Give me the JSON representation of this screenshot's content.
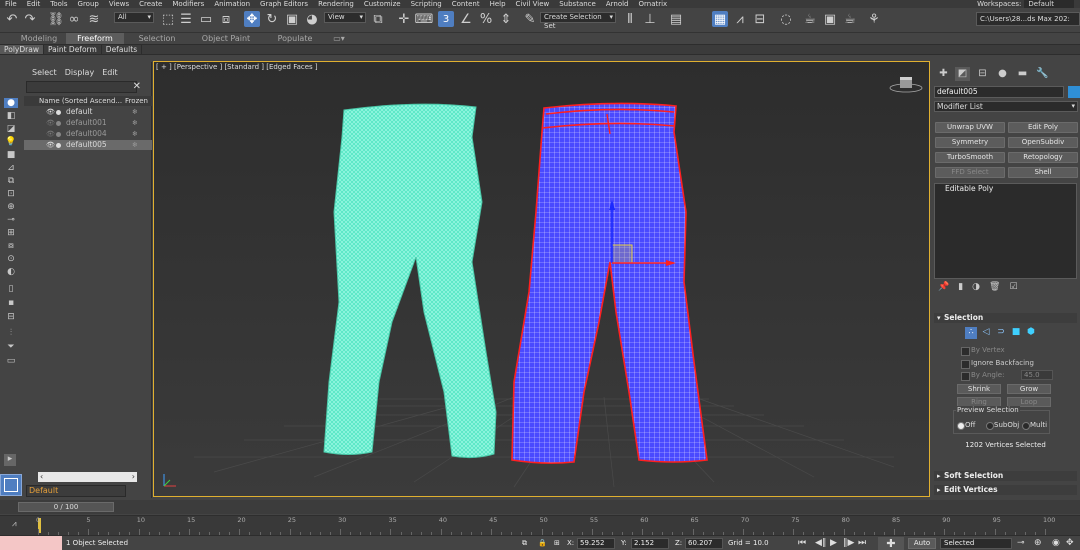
{
  "menu": {
    "items": [
      "File",
      "Edit",
      "Tools",
      "Group",
      "Views",
      "Create",
      "Modifiers",
      "Animation",
      "Graph Editors",
      "Rendering",
      "Customize",
      "Scripting",
      "Content",
      "Help",
      "Civil View",
      "Substance",
      "Arnold",
      "Ornatrix"
    ],
    "workspaces_label": "Workspaces:",
    "workspaces_value": "Default"
  },
  "toolbar": {
    "filter_value": "All",
    "refcoord_value": "View",
    "selection_set_placeholder": "Create Selection Set",
    "project_path": "C:\\Users\\28...ds Max 202:"
  },
  "ribbon": {
    "tabs": [
      "Modeling",
      "Freeform",
      "Selection",
      "Object Paint",
      "Populate"
    ],
    "active_tab": "Freeform",
    "subtabs": [
      "PolyDraw",
      "Paint Deform",
      "Defaults"
    ]
  },
  "explorer": {
    "menu": [
      "Select",
      "Display",
      "Edit"
    ],
    "column_name": "Name (Sorted Ascend...",
    "column_frozen": "Frozen",
    "rows": [
      {
        "name": "default",
        "dim": false,
        "selected": false
      },
      {
        "name": "default001",
        "dim": true,
        "selected": false
      },
      {
        "name": "default004",
        "dim": true,
        "selected": false
      },
      {
        "name": "default005",
        "dim": false,
        "selected": true
      }
    ],
    "layer": "Default"
  },
  "viewport": {
    "label": "[ + ] [Perspective ] [Standard ] [Edged Faces ]",
    "accent": "#e0b030",
    "mesh_left_color": "#5fe8c8",
    "mesh_right_color": "#4a4aff",
    "selection_edge_color": "#ff2020"
  },
  "command_panel": {
    "object_name": "default005",
    "object_color": "#2f8fd6",
    "modifier_list": "Modifier List",
    "buttons": [
      {
        "label": "Unwrap UVW",
        "disabled": false
      },
      {
        "label": "Edit Poly",
        "disabled": false
      },
      {
        "label": "Symmetry",
        "disabled": false
      },
      {
        "label": "OpenSubdiv",
        "disabled": false
      },
      {
        "label": "TurboSmooth",
        "disabled": false
      },
      {
        "label": "Retopology",
        "disabled": false
      },
      {
        "label": "FFD Select",
        "disabled": true
      },
      {
        "label": "Shell",
        "disabled": false
      }
    ],
    "stack_item": "Editable Poly",
    "selection": {
      "title": "Selection",
      "by_vertex": "By Vertex",
      "ignore_backfacing": "Ignore Backfacing",
      "by_angle": "By Angle:",
      "angle_value": "45.0",
      "shrink": "Shrink",
      "grow": "Grow",
      "ring": "Ring",
      "loop": "Loop",
      "preview_label": "Preview Selection",
      "preview_off": "Off",
      "preview_subobj": "SubObj",
      "preview_multi": "Multi",
      "status": "1202 Vertices Selected"
    },
    "soft_selection": "Soft Selection",
    "edit_vertices": "Edit Vertices"
  },
  "timeline": {
    "frame_display": "0 / 100",
    "ticks": [
      "0",
      "5",
      "10",
      "15",
      "20",
      "25",
      "30",
      "35",
      "40",
      "45",
      "50",
      "55",
      "60",
      "65",
      "70",
      "75",
      "80",
      "85",
      "90",
      "95",
      "100"
    ]
  },
  "status": {
    "selection_text": "1 Object Selected",
    "x_label": "X:",
    "x_value": "59.252",
    "y_label": "Y:",
    "y_value": "2.152",
    "z_label": "Z:",
    "z_value": "60.207",
    "grid": "Grid = 10.0",
    "auto_label": "Auto",
    "selected_dropdown": "Selected"
  }
}
